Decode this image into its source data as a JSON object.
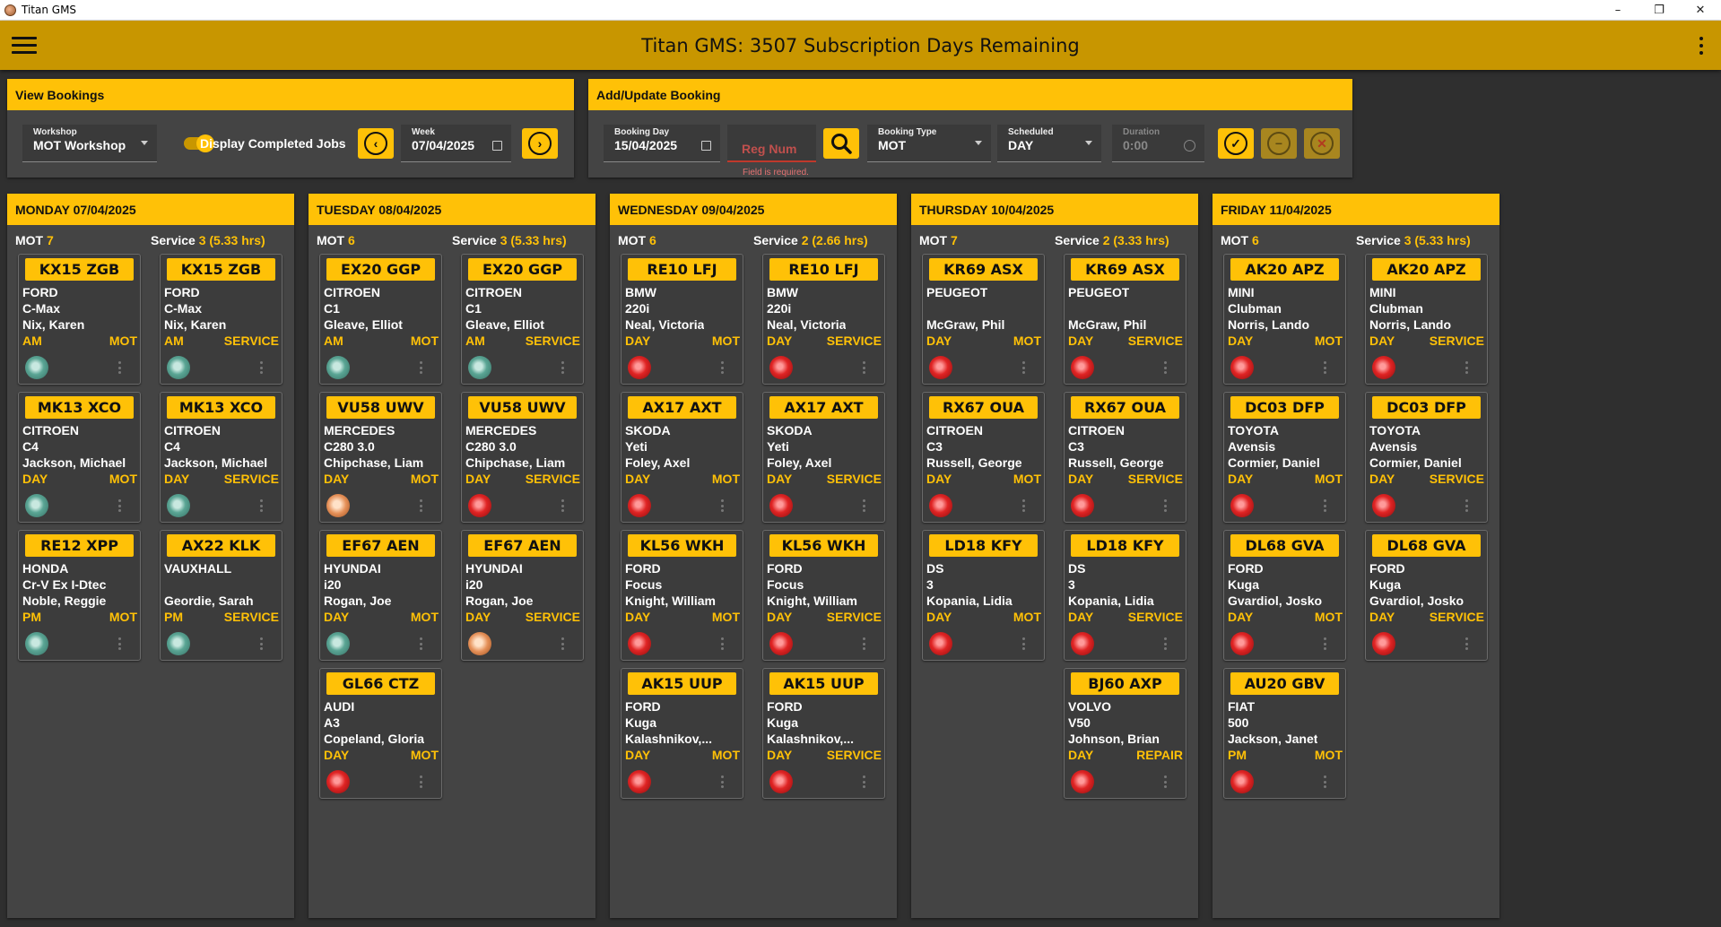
{
  "window": {
    "title": "Titan GMS",
    "controls": [
      "–",
      "❐",
      "✕"
    ]
  },
  "appbar": {
    "title": "Titan GMS: 3507 Subscription Days Remaining"
  },
  "view_bookings": {
    "header": "View Bookings",
    "workshop_label": "Workshop",
    "workshop_value": "MOT Workshop",
    "toggle_label": "Display Completed Jobs",
    "week_label": "Week",
    "week_value": "07/04/2025"
  },
  "add_update": {
    "header": "Add/Update Booking",
    "booking_day_label": "Booking Day",
    "booking_day_value": "15/04/2025",
    "reg_placeholder": "Reg Num",
    "reg_error": "Field is required.",
    "booking_type_label": "Booking Type",
    "booking_type_value": "MOT",
    "scheduled_label": "Scheduled",
    "scheduled_value": "DAY",
    "duration_label": "Duration",
    "duration_value": "0:00"
  },
  "days": [
    {
      "title": "MONDAY 07/04/2025",
      "mot_label": "MOT",
      "mot_count": "7",
      "service_label": "Service",
      "service_count": "3 (5.33 hrs)",
      "mot": [
        {
          "reg": "KX15 ZGB",
          "make": "FORD",
          "model": "C-Max",
          "customer": "Nix, Karen",
          "slot": "AM",
          "type": "MOT",
          "status": "teal"
        },
        {
          "reg": "MK13 XCO",
          "make": "CITROEN",
          "model": "C4",
          "customer": "Jackson, Michael",
          "slot": "DAY",
          "type": "MOT",
          "status": "teal"
        },
        {
          "reg": "RE12 XPP",
          "make": "HONDA",
          "model": "Cr-V Ex I-Dtec",
          "customer": "Noble, Reggie",
          "slot": "PM",
          "type": "MOT",
          "status": "teal"
        }
      ],
      "service": [
        {
          "reg": "KX15 ZGB",
          "make": "FORD",
          "model": "C-Max",
          "customer": "Nix, Karen",
          "slot": "AM",
          "type": "SERVICE",
          "status": "teal"
        },
        {
          "reg": "MK13 XCO",
          "make": "CITROEN",
          "model": "C4",
          "customer": "Jackson, Michael",
          "slot": "DAY",
          "type": "SERVICE",
          "status": "teal"
        },
        {
          "reg": "AX22 KLK",
          "make": "VAUXHALL",
          "model": "",
          "customer": "Geordie, Sarah",
          "slot": "PM",
          "type": "SERVICE",
          "status": "teal"
        }
      ]
    },
    {
      "title": "TUESDAY 08/04/2025",
      "mot_label": "MOT",
      "mot_count": "6",
      "service_label": "Service",
      "service_count": "3 (5.33 hrs)",
      "mot": [
        {
          "reg": "EX20 GGP",
          "make": "CITROEN",
          "model": "C1",
          "customer": "Gleave, Elliot",
          "slot": "AM",
          "type": "MOT",
          "status": "teal"
        },
        {
          "reg": "VU58 UWV",
          "make": "MERCEDES",
          "model": "C280 3.0",
          "customer": "Chipchase, Liam",
          "slot": "DAY",
          "type": "MOT",
          "status": "orange"
        },
        {
          "reg": "EF67 AEN",
          "make": "HYUNDAI",
          "model": "i20",
          "customer": "Rogan, Joe",
          "slot": "DAY",
          "type": "MOT",
          "status": "teal"
        },
        {
          "reg": "GL66 CTZ",
          "make": "AUDI",
          "model": "A3",
          "customer": "Copeland, Gloria",
          "slot": "DAY",
          "type": "MOT",
          "status": "red"
        }
      ],
      "service": [
        {
          "reg": "EX20 GGP",
          "make": "CITROEN",
          "model": "C1",
          "customer": "Gleave, Elliot",
          "slot": "AM",
          "type": "SERVICE",
          "status": "teal"
        },
        {
          "reg": "VU58 UWV",
          "make": "MERCEDES",
          "model": "C280 3.0",
          "customer": "Chipchase, Liam",
          "slot": "DAY",
          "type": "SERVICE",
          "status": "red"
        },
        {
          "reg": "EF67 AEN",
          "make": "HYUNDAI",
          "model": "i20",
          "customer": "Rogan, Joe",
          "slot": "DAY",
          "type": "SERVICE",
          "status": "orange"
        }
      ]
    },
    {
      "title": "WEDNESDAY 09/04/2025",
      "mot_label": "MOT",
      "mot_count": "6",
      "service_label": "Service",
      "service_count": "2 (2.66 hrs)",
      "mot": [
        {
          "reg": "RE10 LFJ",
          "make": "BMW",
          "model": "220i",
          "customer": "Neal, Victoria",
          "slot": "DAY",
          "type": "MOT",
          "status": "red"
        },
        {
          "reg": "AX17 AXT",
          "make": "SKODA",
          "model": "Yeti",
          "customer": "Foley, Axel",
          "slot": "DAY",
          "type": "MOT",
          "status": "red"
        },
        {
          "reg": "KL56 WKH",
          "make": "FORD",
          "model": "Focus",
          "customer": "Knight, William",
          "slot": "DAY",
          "type": "MOT",
          "status": "red"
        },
        {
          "reg": "AK15 UUP",
          "make": "FORD",
          "model": "Kuga",
          "customer": "Kalashnikov,...",
          "slot": "DAY",
          "type": "MOT",
          "status": "red"
        }
      ],
      "service": [
        {
          "reg": "RE10 LFJ",
          "make": "BMW",
          "model": "220i",
          "customer": "Neal, Victoria",
          "slot": "DAY",
          "type": "SERVICE",
          "status": "red"
        },
        {
          "reg": "AX17 AXT",
          "make": "SKODA",
          "model": "Yeti",
          "customer": "Foley, Axel",
          "slot": "DAY",
          "type": "SERVICE",
          "status": "red"
        },
        {
          "reg": "KL56 WKH",
          "make": "FORD",
          "model": "Focus",
          "customer": "Knight, William",
          "slot": "DAY",
          "type": "SERVICE",
          "status": "red"
        },
        {
          "reg": "AK15 UUP",
          "make": "FORD",
          "model": "Kuga",
          "customer": "Kalashnikov,...",
          "slot": "DAY",
          "type": "SERVICE",
          "status": "red"
        }
      ]
    },
    {
      "title": "THURSDAY 10/04/2025",
      "mot_label": "MOT",
      "mot_count": "7",
      "service_label": "Service",
      "service_count": "2 (3.33 hrs)",
      "mot": [
        {
          "reg": "KR69 ASX",
          "make": "PEUGEOT",
          "model": "",
          "customer": "McGraw, Phil",
          "slot": "DAY",
          "type": "MOT",
          "status": "red"
        },
        {
          "reg": "RX67 OUA",
          "make": "CITROEN",
          "model": "C3",
          "customer": "Russell, George",
          "slot": "DAY",
          "type": "MOT",
          "status": "red"
        },
        {
          "reg": "LD18 KFY",
          "make": "DS",
          "model": "3",
          "customer": "Kopania, Lidia",
          "slot": "DAY",
          "type": "MOT",
          "status": "red"
        }
      ],
      "service": [
        {
          "reg": "KR69 ASX",
          "make": "PEUGEOT",
          "model": "",
          "customer": "McGraw, Phil",
          "slot": "DAY",
          "type": "SERVICE",
          "status": "red"
        },
        {
          "reg": "RX67 OUA",
          "make": "CITROEN",
          "model": "C3",
          "customer": "Russell, George",
          "slot": "DAY",
          "type": "SERVICE",
          "status": "red"
        },
        {
          "reg": "LD18 KFY",
          "make": "DS",
          "model": "3",
          "customer": "Kopania, Lidia",
          "slot": "DAY",
          "type": "SERVICE",
          "status": "red"
        },
        {
          "reg": "BJ60 AXP",
          "make": "VOLVO",
          "model": "V50",
          "customer": "Johnson, Brian",
          "slot": "DAY",
          "type": "REPAIR",
          "status": "red"
        }
      ]
    },
    {
      "title": "FRIDAY 11/04/2025",
      "mot_label": "MOT",
      "mot_count": "6",
      "service_label": "Service",
      "service_count": "3 (5.33 hrs)",
      "mot": [
        {
          "reg": "AK20 APZ",
          "make": "MINI",
          "model": "Clubman",
          "customer": "Norris, Lando",
          "slot": "DAY",
          "type": "MOT",
          "status": "red"
        },
        {
          "reg": "DC03 DFP",
          "make": "TOYOTA",
          "model": "Avensis",
          "customer": "Cormier, Daniel",
          "slot": "DAY",
          "type": "MOT",
          "status": "red"
        },
        {
          "reg": "DL68 GVA",
          "make": "FORD",
          "model": "Kuga",
          "customer": "Gvardiol, Josko",
          "slot": "DAY",
          "type": "MOT",
          "status": "red"
        },
        {
          "reg": "AU20 GBV",
          "make": "FIAT",
          "model": "500",
          "customer": "Jackson, Janet",
          "slot": "PM",
          "type": "MOT",
          "status": "red"
        }
      ],
      "service": [
        {
          "reg": "AK20 APZ",
          "make": "MINI",
          "model": "Clubman",
          "customer": "Norris, Lando",
          "slot": "DAY",
          "type": "SERVICE",
          "status": "red"
        },
        {
          "reg": "DC03 DFP",
          "make": "TOYOTA",
          "model": "Avensis",
          "customer": "Cormier, Daniel",
          "slot": "DAY",
          "type": "SERVICE",
          "status": "red"
        },
        {
          "reg": "DL68 GVA",
          "make": "FORD",
          "model": "Kuga",
          "customer": "Gvardiol, Josko",
          "slot": "DAY",
          "type": "SERVICE",
          "status": "red"
        }
      ]
    }
  ],
  "colors": {
    "accent": "#ffc107",
    "appbar": "#c89600",
    "background": "#2f2f2f",
    "panel": "#444444"
  },
  "icons": [
    "app-icon",
    "hamburger-icon",
    "more-vert-icon",
    "chevron-left-icon",
    "chevron-right-icon",
    "calendar-icon",
    "search-icon",
    "check-icon",
    "minus-icon",
    "cancel-icon",
    "clock-icon",
    "status-light-icon"
  ]
}
